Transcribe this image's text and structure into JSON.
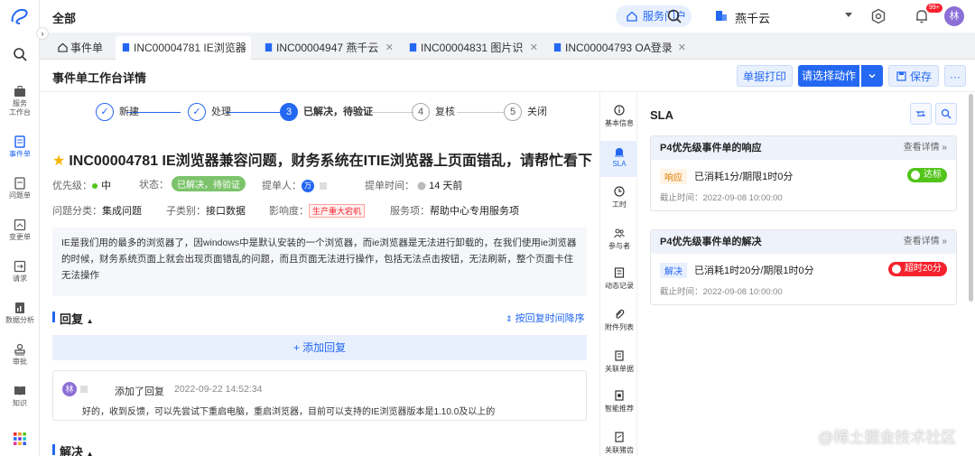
{
  "topbar": {
    "title": "全部",
    "service_portal": "服务门户",
    "org_name": "燕千云",
    "notification_badge": "99+",
    "avatar_initial": "林"
  },
  "rail": {
    "items": [
      {
        "label": "服务\n工作台"
      },
      {
        "label": "事件单"
      },
      {
        "label": "问题单"
      },
      {
        "label": "变更单"
      },
      {
        "label": "请求"
      },
      {
        "label": "数据分析"
      },
      {
        "label": "审批"
      },
      {
        "label": "知识"
      }
    ]
  },
  "tabs": [
    {
      "label": "事件单"
    },
    {
      "label": "INC00004781 IE浏览器"
    },
    {
      "label": "INC00004947 燕千云"
    },
    {
      "label": "INC00004831 图片识"
    },
    {
      "label": "INC00004793 OA登录"
    }
  ],
  "page_header": {
    "title": "事件单工作台详情",
    "print_label": "单据打印",
    "action_label": "请选择动作",
    "save_label": "保存",
    "more_label": "···"
  },
  "steps": [
    {
      "num": "✓",
      "label": "新建"
    },
    {
      "num": "✓",
      "label": "处理"
    },
    {
      "num": "3",
      "label": "已解决，待验证"
    },
    {
      "num": "4",
      "label": "复核"
    },
    {
      "num": "5",
      "label": "关闭"
    }
  ],
  "ticket": {
    "title": "INC00004781  IE浏览器兼容问题，财务系统在ITIE浏览器上页面错乱，请帮忙看下",
    "priority_label": "优先级：",
    "priority_value": "中",
    "status_label": "状态：",
    "status_value": "已解决，待验证",
    "submitter_label": "提单人：",
    "submitter_initial": "万",
    "submit_time_label": "提单时间：",
    "submit_time_value": "14 天前",
    "category_label": "问题分类：",
    "category_value": "集成问题",
    "subcategory_label": "子类别：",
    "subcategory_value": "接口数据",
    "impact_label": "影响度：",
    "impact_value": "生产重大宕机",
    "service_label": "服务项：",
    "service_value": "帮助中心专用服务项",
    "description": "IE是我们用的最多的浏览器了，因windows中是默认安装的一个浏览器，而ie浏览器是无法进行卸载的，在我们使用ie浏览器的时候，财务系统页面上就会出现页面错乱的问题，而且页面无法进行操作，包括无法点击按钮，无法刷新，整个页面卡住无法操作"
  },
  "reply": {
    "section_title": "回复",
    "sort_label": "按回复时间降序",
    "add_label": "+ 添加回复",
    "item": {
      "avatar": "林",
      "action": "添加了回复",
      "time": "2022-09-22 14:52:34",
      "text": "好的，收到反馈，可以先尝试下重启电脑，重启浏览器，目前可以支持的IE浏览器版本是1.10.0及以上的"
    }
  },
  "resolve_section": {
    "title": "解决"
  },
  "midnav": {
    "items": [
      {
        "label": "基本信息"
      },
      {
        "label": "SLA"
      },
      {
        "label": "工时"
      },
      {
        "label": "参与者"
      },
      {
        "label": "动态记录"
      },
      {
        "label": "附件列表"
      },
      {
        "label": "关联单据"
      },
      {
        "label": "智能推荐"
      },
      {
        "label": "关联猪齿"
      }
    ]
  },
  "sla": {
    "title": "SLA",
    "cards": [
      {
        "title": "P4优先级事件单的响应",
        "more": "查看详情 »",
        "tag": "响应",
        "used": "已消耗1分/期限1时0分",
        "deadline": "截止时间：2022-09-08 10:00:00",
        "badge": "达标"
      },
      {
        "title": "P4优先级事件单的解决",
        "more": "查看详情 »",
        "tag": "解决",
        "used": "已消耗1时20分/期限1时0分",
        "deadline": "截止时间：2022-09-08 10:00:00",
        "badge": "超时20分"
      }
    ]
  },
  "watermark": "@稀土掘金技术社区",
  "colors": {
    "primary": "#2468f2",
    "success": "#52c41a",
    "danger": "#f5222d",
    "warning": "#e07b00"
  }
}
